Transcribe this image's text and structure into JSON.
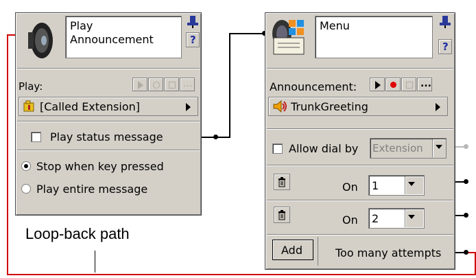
{
  "play_node": {
    "title": "Play\nAnnouncement",
    "play_label": "Play:",
    "source": "[Called Extension]",
    "status_checkbox": "Play status message",
    "radio_stop": "Stop when key pressed",
    "radio_entire": "Play entire message",
    "more": "..."
  },
  "menu_node": {
    "title": "Menu",
    "announcement_label": "Announcement:",
    "greeting": "TrunkGreeting",
    "allow_dial": "Allow dial by",
    "allow_dial_value": "Extension",
    "on_label": "On",
    "option1_value": "1",
    "option2_value": "2",
    "add_label": "Add",
    "too_many": "Too many attempts",
    "more": "..."
  },
  "help": "?",
  "annotation": "Loop-back path"
}
